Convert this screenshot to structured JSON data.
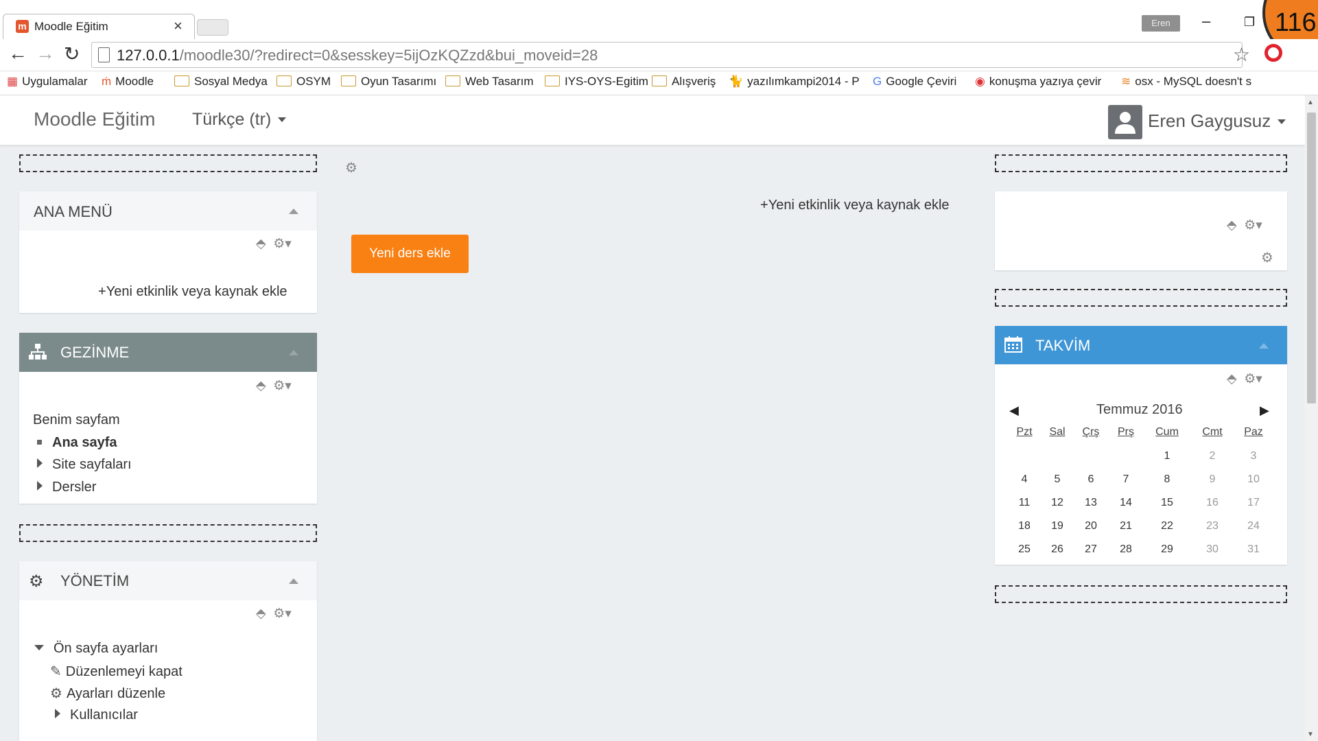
{
  "browser": {
    "tab_title": "Moodle Eğitim",
    "favicon_letter": "m",
    "close_glyph": "×",
    "user_badge": "Eren",
    "counter": "116",
    "url_host": "127.0.0.1",
    "url_path": "/moodle30/?redirect=0&sesskey=5ijOzKQZzd&bui_moveid=28",
    "bookmarks": [
      {
        "label": "Uygulamalar",
        "icon": "apps-grid-icon"
      },
      {
        "label": "Moodle",
        "icon": "moodle-icon"
      },
      {
        "label": "Sosyal Medya",
        "icon": "folder-icon"
      },
      {
        "label": "OSYM",
        "icon": "folder-icon"
      },
      {
        "label": "Oyun Tasarımı",
        "icon": "folder-icon"
      },
      {
        "label": "Web Tasarım",
        "icon": "folder-icon"
      },
      {
        "label": "IYS-OYS-Egitim",
        "icon": "folder-icon"
      },
      {
        "label": "Alışveriş",
        "icon": "folder-icon"
      },
      {
        "label": "yazılımkampi2014 - P",
        "icon": "cat-icon"
      },
      {
        "label": "Google Çeviri",
        "icon": "translate-icon"
      },
      {
        "label": "konuşma yazıya çevir",
        "icon": "chrome-icon"
      },
      {
        "label": "osx - MySQL doesn't s",
        "icon": "stack-icon"
      }
    ]
  },
  "navbar": {
    "brand": "Moodle Eğitim",
    "language": "Türkçe (tr)",
    "user_name": "Eren Gaygusuz"
  },
  "blocks": {
    "ana_menu": {
      "title": "ANA MENÜ",
      "add_link": "Yeni etkinlik veya kaynak ekle"
    },
    "gezinme": {
      "title": "GEZİNME",
      "items": [
        {
          "label": "Benim sayfam",
          "kind": "plain"
        },
        {
          "label": "Ana sayfa",
          "kind": "bullet"
        },
        {
          "label": "Site sayfaları",
          "kind": "expand"
        },
        {
          "label": "Dersler",
          "kind": "expand"
        }
      ]
    },
    "yonetim": {
      "title": "YÖNETİM",
      "items": [
        {
          "label": "Ön sayfa ayarları",
          "kind": "expanded"
        },
        {
          "label": "Düzenlemeyi kapat",
          "kind": "pencil"
        },
        {
          "label": "Ayarları düzenle",
          "kind": "gear"
        },
        {
          "label": "Kullanıcılar",
          "kind": "expand"
        }
      ]
    }
  },
  "main": {
    "add_link": "Yeni etkinlik veya kaynak ekle",
    "add_course_button": "Yeni ders ekle"
  },
  "calendar": {
    "title": "TAKVİM",
    "month": "Temmuz 2016",
    "prev_glyph": "◀",
    "next_glyph": "▶",
    "weekdays": [
      "Pzt",
      "Sal",
      "Çrş",
      "Prş",
      "Cum",
      "Cmt",
      "Paz"
    ],
    "weeks": [
      [
        "",
        "",
        "",
        "",
        "1",
        "2",
        "3"
      ],
      [
        "4",
        "5",
        "6",
        "7",
        "8",
        "9",
        "10"
      ],
      [
        "11",
        "12",
        "13",
        "14",
        "15",
        "16",
        "17"
      ],
      [
        "18",
        "19",
        "20",
        "21",
        "22",
        "23",
        "24"
      ],
      [
        "25",
        "26",
        "27",
        "28",
        "29",
        "30",
        "31"
      ]
    ]
  },
  "colors": {
    "accent_orange": "#f98012",
    "calendar_header": "#3e96d6",
    "gezinme_header": "#7b8a8b"
  }
}
